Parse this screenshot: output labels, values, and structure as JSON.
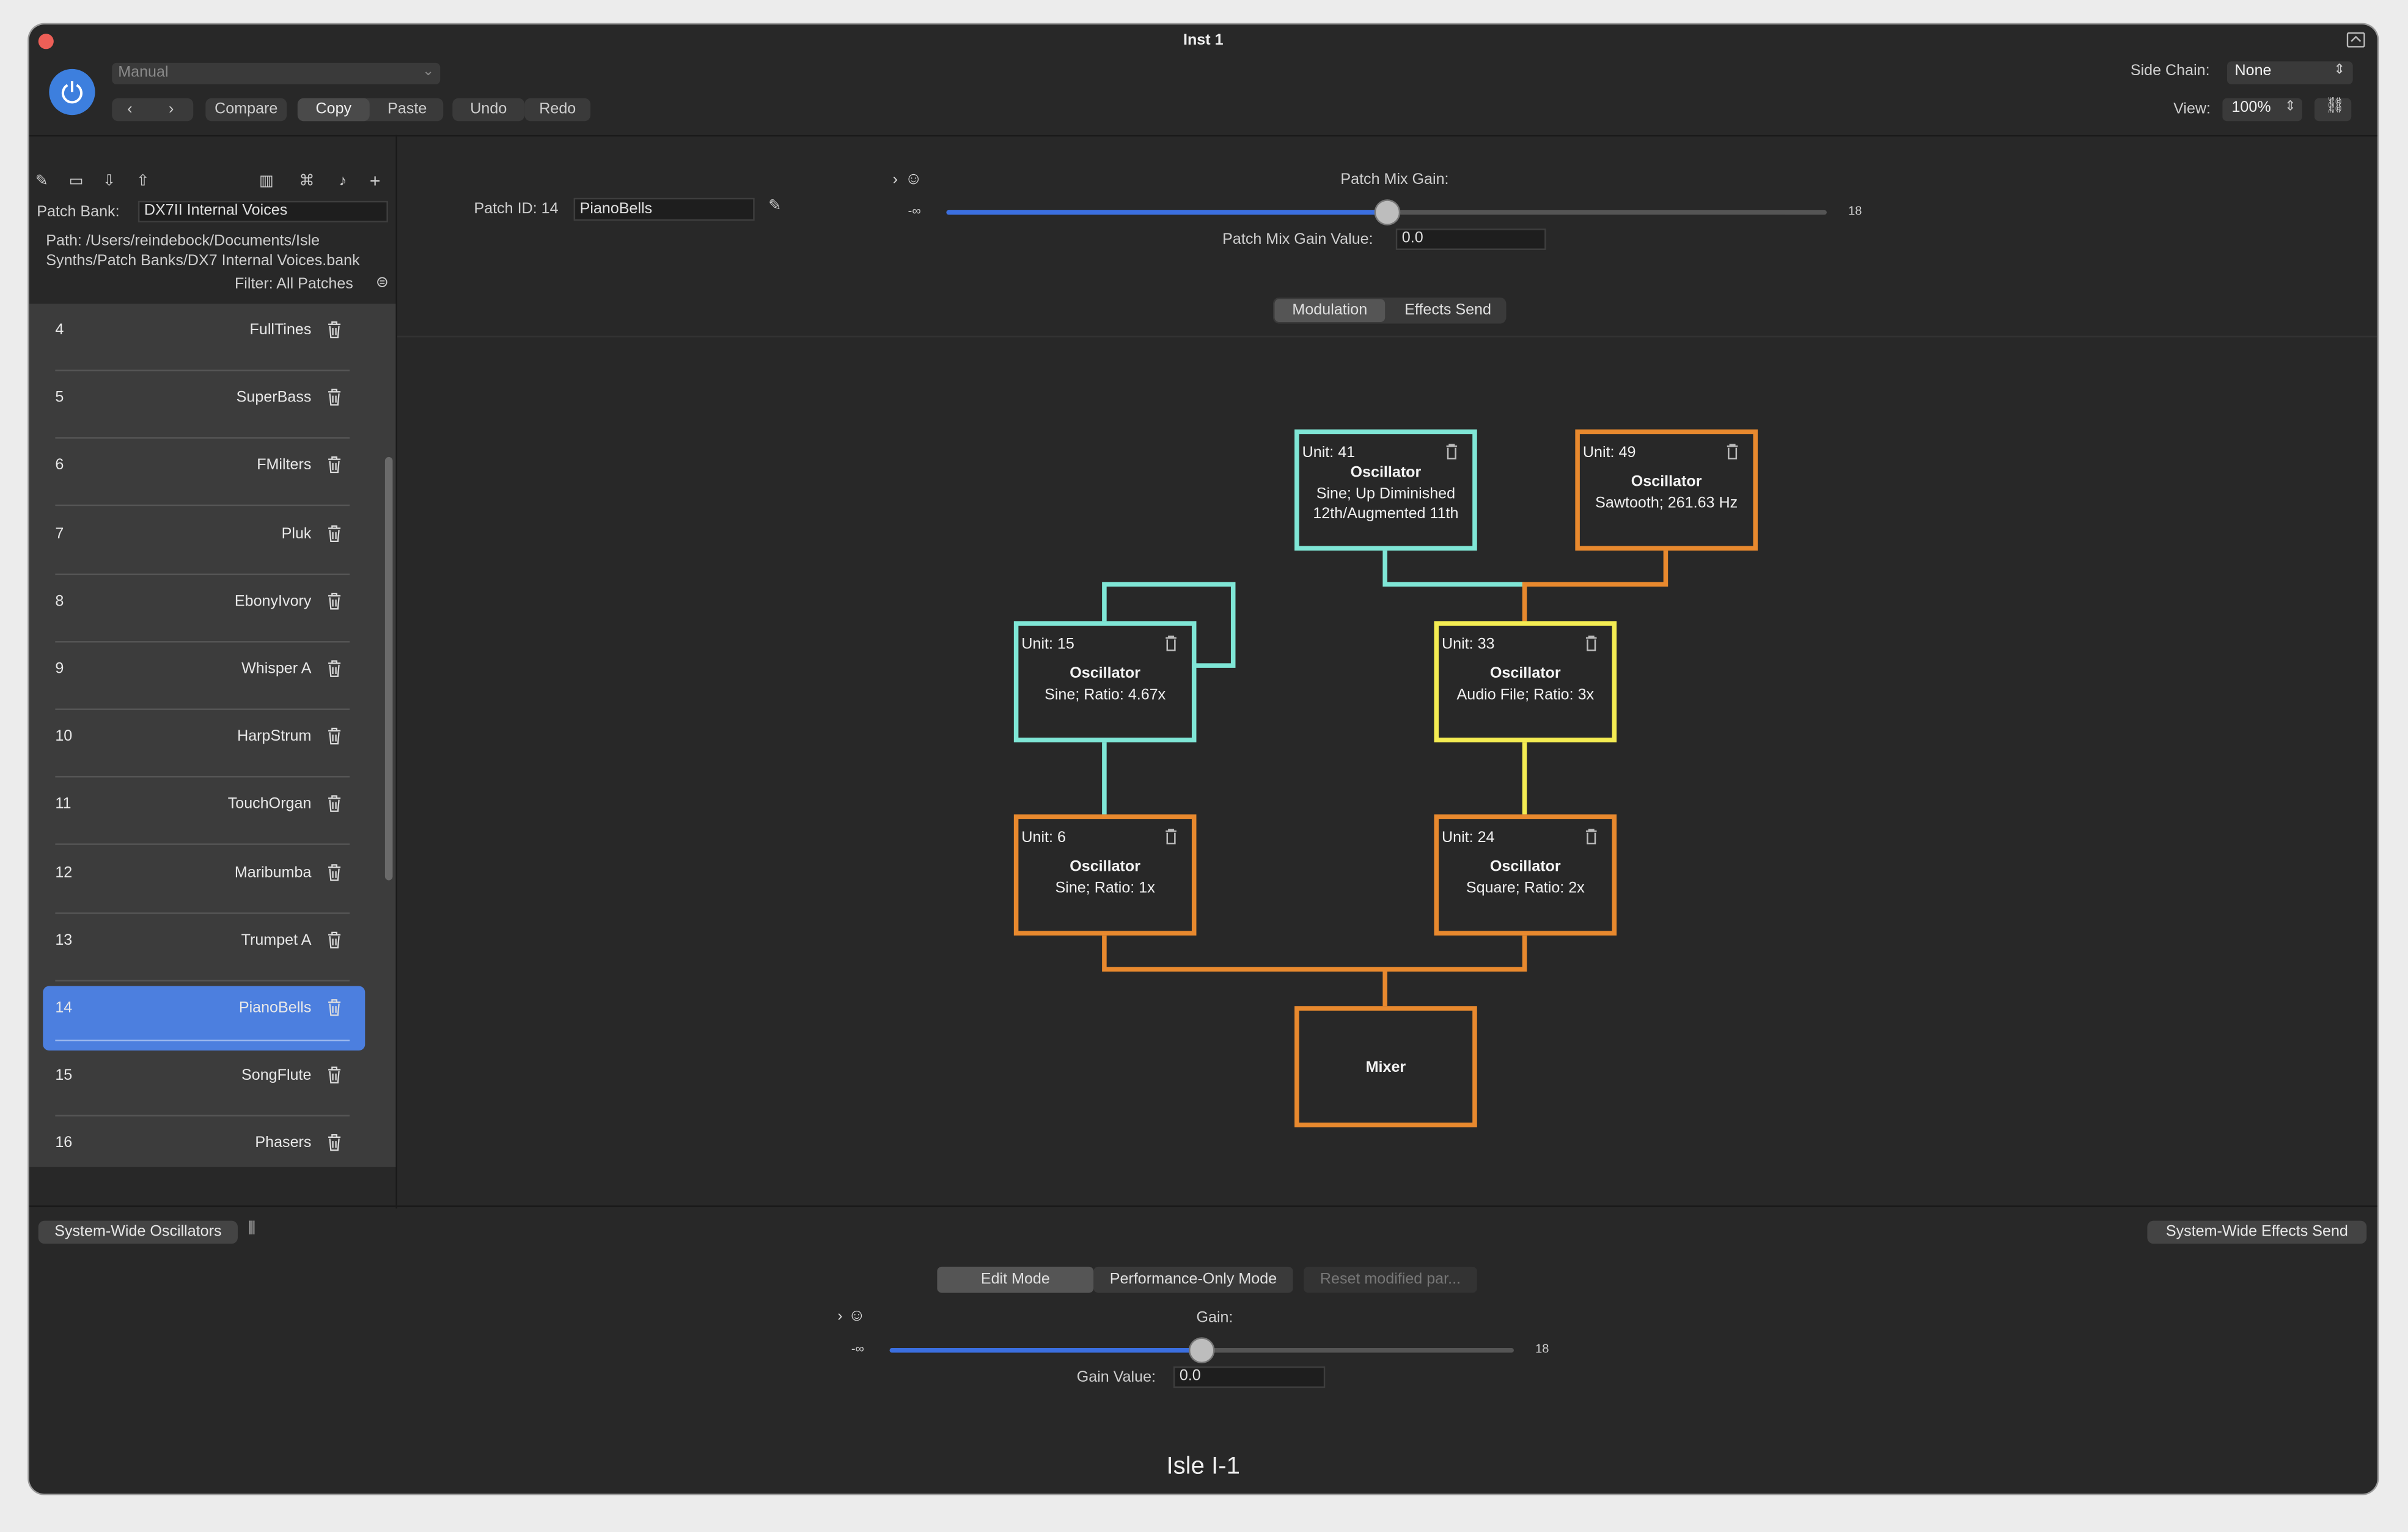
{
  "window": {
    "title": "Inst 1"
  },
  "toolbar": {
    "preset": "Manual",
    "compare": "Compare",
    "copy": "Copy",
    "paste": "Paste",
    "undo": "Undo",
    "redo": "Redo",
    "side_chain_label": "Side Chain:",
    "side_chain_value": "None",
    "view_label": "View:",
    "view_value": "100%"
  },
  "sidebar": {
    "patch_bank_label": "Patch Bank:",
    "patch_bank_value": "DX7II Internal Voices",
    "path_line1": "Path: /Users/reindebock/Documents/Isle",
    "path_line2": "Synths/Patch Banks/DX7 Internal Voices.bank",
    "filter": "Filter: All Patches",
    "patches": [
      {
        "num": "4",
        "name": "FullTines"
      },
      {
        "num": "5",
        "name": "SuperBass"
      },
      {
        "num": "6",
        "name": "FMilters"
      },
      {
        "num": "7",
        "name": "Pluk"
      },
      {
        "num": "8",
        "name": "EbonyIvory"
      },
      {
        "num": "9",
        "name": "Whisper A"
      },
      {
        "num": "10",
        "name": "HarpStrum"
      },
      {
        "num": "11",
        "name": "TouchOrgan"
      },
      {
        "num": "12",
        "name": "Maribumba"
      },
      {
        "num": "13",
        "name": "Trumpet A"
      },
      {
        "num": "14",
        "name": "PianoBells"
      },
      {
        "num": "15",
        "name": "SongFlute"
      },
      {
        "num": "16",
        "name": "Phasers"
      }
    ],
    "selected_index": 10
  },
  "patch": {
    "id_label": "Patch ID: 14",
    "name_value": "PianoBells",
    "mix_gain_label": "Patch Mix Gain:",
    "mix_gain_min": "-∞",
    "mix_gain_max": "18",
    "mix_gain_fraction": 0.5,
    "mix_gain_value_label": "Patch Mix Gain Value:",
    "mix_gain_value": "0.0"
  },
  "tabs": {
    "modulation": "Modulation",
    "effects_send": "Effects Send"
  },
  "graph": {
    "nodes": [
      {
        "unit": "Unit: 41",
        "kind": "Oscillator",
        "desc1": "Sine; Up Diminished",
        "desc2": "12th/Augmented 11th",
        "color": "#7fe6d6"
      },
      {
        "unit": "Unit: 49",
        "kind": "Oscillator",
        "desc1": "Sawtooth; 261.63 Hz",
        "color": "#e8892e"
      },
      {
        "unit": "Unit: 15",
        "kind": "Oscillator",
        "desc1": "Sine; Ratio: 4.67x",
        "color": "#7fe6d6"
      },
      {
        "unit": "Unit: 33",
        "kind": "Oscillator",
        "desc1": "Audio File; Ratio: 3x",
        "color": "#f4ec52"
      },
      {
        "unit": "Unit: 6",
        "kind": "Oscillator",
        "desc1": "Sine; Ratio: 1x",
        "color": "#e8892e"
      },
      {
        "unit": "Unit: 24",
        "kind": "Oscillator",
        "desc1": "Square; Ratio: 2x",
        "color": "#e8892e"
      }
    ],
    "mixer": "Mixer"
  },
  "bottom": {
    "system_oscillators": "System-Wide Oscillators",
    "system_effects": "System-Wide Effects Send",
    "edit_mode": "Edit Mode",
    "performance_mode": "Performance-Only Mode",
    "reset": "Reset modified par...",
    "gain_label": "Gain:",
    "gain_min": "-∞",
    "gain_max": "18",
    "gain_fraction": 0.5,
    "gain_value_label": "Gain Value:",
    "gain_value": "0.0",
    "footer": "Isle I-1"
  }
}
